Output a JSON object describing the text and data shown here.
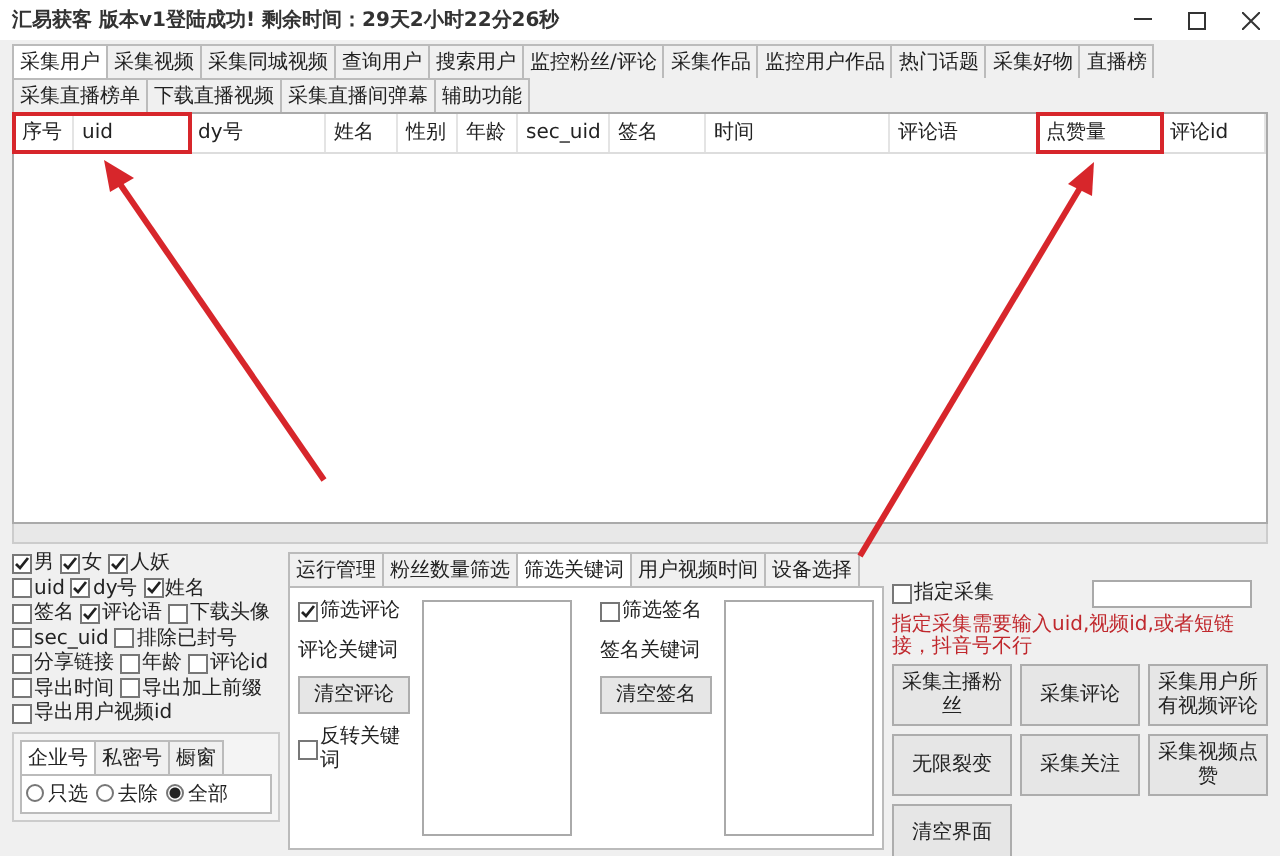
{
  "window": {
    "title": "汇易获客 版本v1登陆成功! 剩余时间：29天2小时22分26秒"
  },
  "tabs": [
    {
      "label": "采集用户",
      "selected": true
    },
    {
      "label": "采集视频",
      "selected": false
    },
    {
      "label": "采集同城视频",
      "selected": false
    },
    {
      "label": "查询用户",
      "selected": false
    },
    {
      "label": "搜索用户",
      "selected": false
    },
    {
      "label": "监控粉丝/评论",
      "selected": false
    },
    {
      "label": "采集作品",
      "selected": false
    },
    {
      "label": "监控用户作品",
      "selected": false
    },
    {
      "label": "热门话题",
      "selected": false
    },
    {
      "label": "采集好物",
      "selected": false
    },
    {
      "label": "直播榜",
      "selected": false
    },
    {
      "label": "采集直播榜单",
      "selected": false
    },
    {
      "label": "下载直播视频",
      "selected": false
    },
    {
      "label": "采集直播间弹幕",
      "selected": false
    },
    {
      "label": "辅助功能",
      "selected": false
    }
  ],
  "table": {
    "columns": [
      "序号",
      "uid",
      "dy号",
      "姓名",
      "性别",
      "年龄",
      "sec_uid",
      "签名",
      "时间",
      "评论语",
      "点赞量",
      "评论id"
    ]
  },
  "filters": [
    [
      {
        "label": "男",
        "checked": true
      },
      {
        "label": "女",
        "checked": true
      },
      {
        "label": "人妖",
        "checked": true
      }
    ],
    [
      {
        "label": "uid",
        "checked": false
      },
      {
        "label": "dy号",
        "checked": true
      },
      {
        "label": "姓名",
        "checked": true
      }
    ],
    [
      {
        "label": "签名",
        "checked": false
      },
      {
        "label": "评论语",
        "checked": true
      },
      {
        "label": "下载头像",
        "checked": false
      }
    ],
    [
      {
        "label": "sec_uid",
        "checked": false
      },
      {
        "label": "排除已封号",
        "checked": false
      }
    ],
    [
      {
        "label": "分享链接",
        "checked": false
      },
      {
        "label": "年龄",
        "checked": false
      },
      {
        "label": "评论id",
        "checked": false
      }
    ],
    [
      {
        "label": "导出时间",
        "checked": false
      },
      {
        "label": "导出加上前缀",
        "checked": false
      }
    ],
    [
      {
        "label": "导出用户视频id",
        "checked": false
      }
    ]
  ],
  "account_group": {
    "tabs": [
      {
        "label": "企业号",
        "selected": true
      },
      {
        "label": "私密号",
        "selected": false
      },
      {
        "label": "橱窗",
        "selected": false
      }
    ],
    "radios": [
      {
        "label": "只选",
        "selected": false
      },
      {
        "label": "去除",
        "selected": false
      },
      {
        "label": "全部",
        "selected": true
      }
    ]
  },
  "settings": {
    "tabs": [
      {
        "label": "运行管理",
        "selected": false
      },
      {
        "label": "粉丝数量筛选",
        "selected": false
      },
      {
        "label": "筛选关键词",
        "selected": true
      },
      {
        "label": "用户视频时间",
        "selected": false
      },
      {
        "label": "设备选择",
        "selected": false
      }
    ],
    "comment": {
      "checkbox": {
        "label": "筛选评论",
        "checked": true
      },
      "label": "评论关键词",
      "button": "清空评论",
      "invert": {
        "label": "反转关键词",
        "checked": false
      }
    },
    "signature": {
      "checkbox": {
        "label": "筛选签名",
        "checked": false
      },
      "label": "签名关键词",
      "button": "清空签名"
    }
  },
  "collect": {
    "checkbox": {
      "label": "指定采集",
      "checked": false
    },
    "note": "指定采集需要输入uid,视频id,或者短链接，抖音号不行",
    "buttons": [
      "采集主播粉丝",
      "采集评论",
      "采集用户所有视频评论",
      "无限裂变",
      "采集关注",
      "采集视频点赞",
      "清空界面"
    ]
  }
}
